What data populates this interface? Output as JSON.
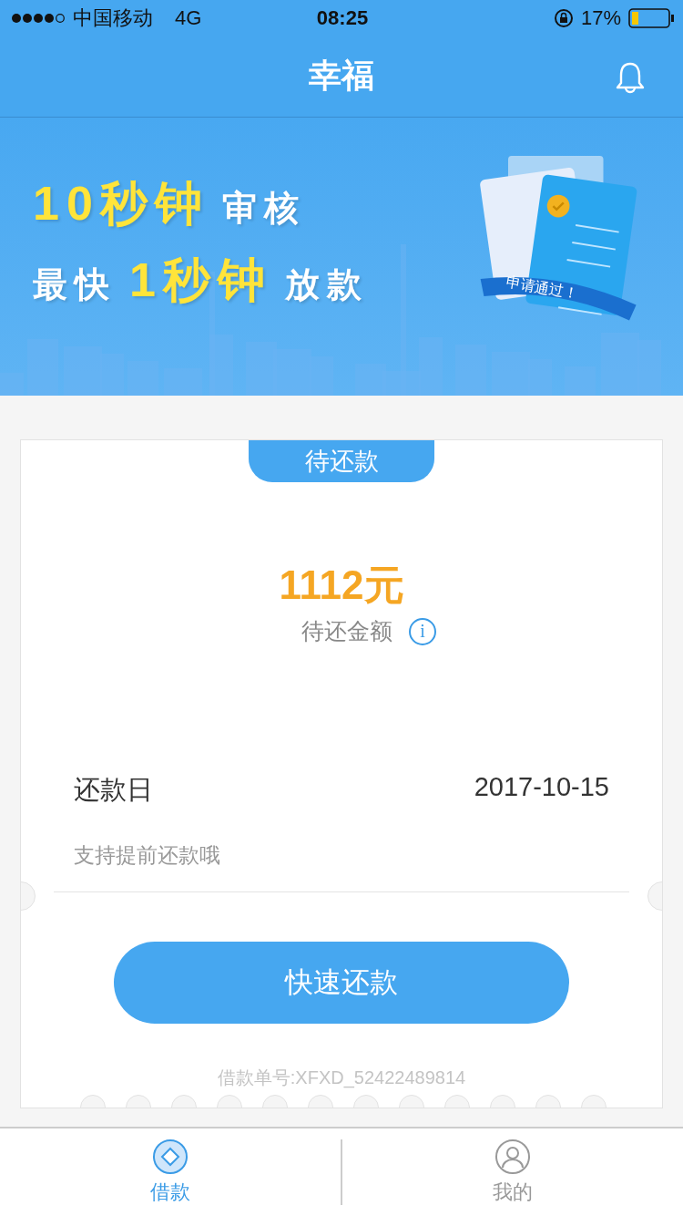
{
  "status_bar": {
    "carrier": "中国移动",
    "network": "4G",
    "time": "08:25",
    "battery_percent": "17%"
  },
  "nav_bar": {
    "title": "幸福"
  },
  "banner": {
    "lines": [
      [
        {
          "text": "10秒钟",
          "highlight": true
        },
        {
          "text": "审核",
          "highlight": false
        }
      ],
      [
        {
          "text": "最快",
          "highlight": false
        },
        {
          "text": "1秒钟",
          "highlight": true
        },
        {
          "text": "放款",
          "highlight": false
        }
      ]
    ],
    "ribbon": "申请通过！"
  },
  "loan_card": {
    "tab": "待还款",
    "amount": "1112元",
    "amount_label": "待还金额",
    "info_icon": "i",
    "due_label": "还款日",
    "due_date": "2017-10-15",
    "hint": "支持提前还款哦",
    "button": "快速还款",
    "order_number": "借款单号:XFXD_52422489814"
  },
  "tab_bar": [
    {
      "label": "借款",
      "kind": "loan",
      "selected": true
    },
    {
      "label": "我的",
      "kind": "profile",
      "selected": false
    }
  ]
}
